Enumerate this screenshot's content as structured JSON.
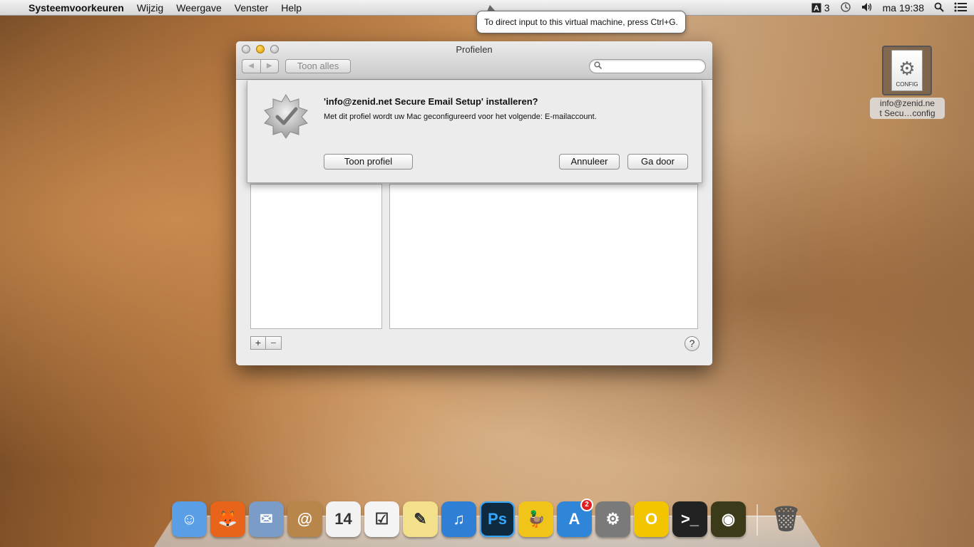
{
  "menubar": {
    "apple": "",
    "app_name": "Systeemvoorkeuren",
    "items": [
      "Wijzig",
      "Weergave",
      "Venster",
      "Help"
    ],
    "input_badge": "3",
    "clock": "ma 19:38"
  },
  "tooltip": {
    "text": "To direct input to this virtual machine, press Ctrl+G."
  },
  "window": {
    "title": "Profielen",
    "back": "◀",
    "forward": "▶",
    "show_all": "Toon alles",
    "search_placeholder": "",
    "add": "+",
    "remove": "−",
    "help": "?"
  },
  "sheet": {
    "title": "'info@zenid.net Secure Email Setup' installeren?",
    "message": "Met dit profiel wordt uw Mac geconfigureerd voor het volgende: E-mailaccount.",
    "show_profile": "Toon profiel",
    "cancel": "Annuleer",
    "continue": "Ga door"
  },
  "desktop_file": {
    "icon_label": "CONFIG",
    "name_line1": "info@zenid.ne",
    "name_line2": "t Secu…config"
  },
  "dock": {
    "items": [
      {
        "name": "finder",
        "glyph": "☺",
        "color": "#5a9ee6"
      },
      {
        "name": "firefox",
        "glyph": "🦊",
        "color": "#e8641b"
      },
      {
        "name": "mail",
        "glyph": "✉",
        "color": "#7a9cc6"
      },
      {
        "name": "contacts",
        "glyph": "@",
        "color": "#b8864b"
      },
      {
        "name": "calendar",
        "glyph": "14",
        "color": "#f2f2f2"
      },
      {
        "name": "reminders",
        "glyph": "☑",
        "color": "#f4f4f4"
      },
      {
        "name": "notes",
        "glyph": "✎",
        "color": "#f3e08a"
      },
      {
        "name": "itunes",
        "glyph": "♫",
        "color": "#2f7fd6"
      },
      {
        "name": "photoshop",
        "glyph": "Ps",
        "color": "#0f2a3e"
      },
      {
        "name": "cyberduck",
        "glyph": "🦆",
        "color": "#f0c419"
      },
      {
        "name": "app-store",
        "glyph": "A",
        "color": "#2f86d8",
        "badge": "2"
      },
      {
        "name": "system-preferences",
        "glyph": "⚙",
        "color": "#7a7a7a"
      },
      {
        "name": "opera",
        "glyph": "O",
        "color": "#f2c500"
      },
      {
        "name": "terminal",
        "glyph": ">_",
        "color": "#222222"
      },
      {
        "name": "radar",
        "glyph": "◉",
        "color": "#3b3b1a"
      }
    ],
    "trash_glyph": "🗑"
  }
}
